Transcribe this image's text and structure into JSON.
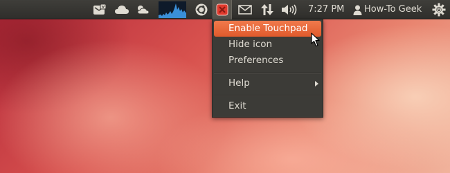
{
  "panel": {
    "indicators": [
      {
        "icon": "messaging-envelope-icon"
      },
      {
        "icon": "ubuntu-one-cloud-icon"
      },
      {
        "icon": "weather-icon"
      },
      {
        "icon": "system-load-graph-icon"
      },
      {
        "icon": "ubuntu-logo-icon"
      },
      {
        "icon": "touchpad-indicator-icon"
      },
      {
        "icon": "mail-envelope-icon"
      },
      {
        "icon": "network-updown-icon"
      },
      {
        "icon": "volume-icon"
      }
    ],
    "clock": "7:27 PM",
    "user_name": "How-To Geek",
    "session_icon": "power-gear-icon"
  },
  "touchpad_menu": {
    "items": [
      {
        "label": "Enable Touchpad",
        "highlighted": true
      },
      {
        "label": "Hide icon"
      },
      {
        "label": "Preferences"
      },
      {
        "label": "Help",
        "submenu": true
      },
      {
        "label": "Exit"
      }
    ]
  },
  "colors": {
    "panel": "#3c3b37",
    "menu_background": "#3c3b37",
    "highlight": "#e8622f",
    "text": "#dfdbd2",
    "touchpad_icon_red": "#e03a2d",
    "graph_blue": "#3a8fd8"
  }
}
